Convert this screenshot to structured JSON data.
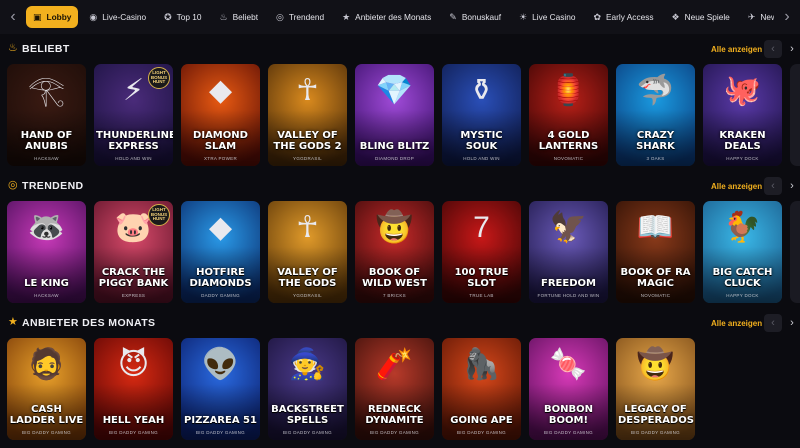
{
  "nav": {
    "items": [
      {
        "label": "Lobby",
        "icon": "lobby-icon",
        "glyph": "▣",
        "active": true
      },
      {
        "label": "Live-Casino",
        "icon": "live-icon",
        "glyph": "◉",
        "active": false
      },
      {
        "label": "Top 10",
        "icon": "medal-icon",
        "glyph": "✪",
        "active": false
      },
      {
        "label": "Beliebt",
        "icon": "flame-icon",
        "glyph": "♨",
        "active": false
      },
      {
        "label": "Trendend",
        "icon": "trend-icon",
        "glyph": "◎",
        "active": false
      },
      {
        "label": "Anbieter des Monats",
        "icon": "star-icon",
        "glyph": "★",
        "active": false
      },
      {
        "label": "Bonuskauf",
        "icon": "bonus-icon",
        "glyph": "✎",
        "active": false
      },
      {
        "label": "Live Casino",
        "icon": "live-casino-icon",
        "glyph": "☀",
        "active": false
      },
      {
        "label": "Early Access",
        "icon": "early-access-icon",
        "glyph": "✿",
        "active": false
      },
      {
        "label": "Neue Spiele",
        "icon": "new-games-icon",
        "glyph": "❖",
        "active": false
      },
      {
        "label": "New Providers",
        "icon": "new-providers-icon",
        "glyph": "✈",
        "active": false
      }
    ]
  },
  "colors": {
    "accent": "#f2b01e",
    "background": "#0b0b10"
  },
  "sections": [
    {
      "title": "BELIEBT",
      "icon": "flame-icon",
      "glyph": "♨",
      "show_all": "Alle anzeigen",
      "games": [
        {
          "name": "Hand of Anubis",
          "provider": "Hacksaw",
          "glyph": "𓂀",
          "bg": [
            "#3a1a12",
            "#1b0c08"
          ]
        },
        {
          "name": "Thunderline Express",
          "provider": "Hold and Win",
          "glyph": "⚡",
          "bg": [
            "#4a2b7a",
            "#1b1240"
          ],
          "badge": "LIGHT BONUS HUNT"
        },
        {
          "name": "Diamond Slam",
          "provider": "Xtra Power",
          "glyph": "◆",
          "bg": [
            "#e85a12",
            "#5a0d05"
          ]
        },
        {
          "name": "Valley of the Gods 2",
          "provider": "Yggdrasil",
          "glyph": "☥",
          "bg": [
            "#d98a1e",
            "#4a2a08"
          ]
        },
        {
          "name": "Bling Blitz",
          "provider": "Diamond Drop",
          "glyph": "💎",
          "bg": [
            "#a04bd8",
            "#3a0f6a"
          ]
        },
        {
          "name": "Mystic Souk",
          "provider": "Hold and Win",
          "glyph": "⚱",
          "bg": [
            "#2a4fb8",
            "#0e1a4a"
          ]
        },
        {
          "name": "4 Gold Lanterns",
          "provider": "Novomatic",
          "glyph": "🏮",
          "bg": [
            "#b82018",
            "#3a0505"
          ]
        },
        {
          "name": "Crazy Shark",
          "provider": "3 Oaks",
          "glyph": "🦈",
          "bg": [
            "#1a9ae0",
            "#0a3a7a"
          ]
        },
        {
          "name": "Kraken Deals",
          "provider": "Happy Dock",
          "glyph": "🐙",
          "bg": [
            "#5a3aa8",
            "#1e1248"
          ]
        }
      ]
    },
    {
      "title": "TRENDEND",
      "icon": "trend-icon",
      "glyph": "◎",
      "show_all": "Alle anzeigen",
      "games": [
        {
          "name": "Le King",
          "provider": "Hacksaw",
          "glyph": "🦝",
          "bg": [
            "#c83ab8",
            "#4a0f5a"
          ]
        },
        {
          "name": "Crack the Piggy Bank",
          "provider": "Express",
          "glyph": "🐷",
          "bg": [
            "#d84a6a",
            "#5a1228"
          ],
          "badge": "LIGHT BONUS HUNT"
        },
        {
          "name": "Hotfire Diamonds",
          "provider": "Daddy Gaming",
          "glyph": "◆",
          "bg": [
            "#2a9ae8",
            "#0a2a6a"
          ]
        },
        {
          "name": "Valley of the Gods",
          "provider": "Yggdrasil",
          "glyph": "☥",
          "bg": [
            "#e09a2a",
            "#5a3508"
          ]
        },
        {
          "name": "Book of Wild West",
          "provider": "7 Bricks",
          "glyph": "🤠",
          "bg": [
            "#c82a2a",
            "#3a0a0a"
          ]
        },
        {
          "name": "100 True Slot",
          "provider": "True Lab",
          "glyph": "7",
          "bg": [
            "#c81818",
            "#3a0505"
          ]
        },
        {
          "name": "Freedom",
          "provider": "Fortune Hold and Win",
          "glyph": "🦅",
          "bg": [
            "#6a5ab8",
            "#1e1848"
          ]
        },
        {
          "name": "Book of Ra Magic",
          "provider": "Novomatic",
          "glyph": "📖",
          "bg": [
            "#8a3a1a",
            "#2a0f05"
          ]
        },
        {
          "name": "Big Catch Cluck",
          "provider": "Happy Dock",
          "glyph": "🐓",
          "bg": [
            "#3ab8e8",
            "#1a5a8a"
          ]
        }
      ]
    },
    {
      "title": "ANBIETER DES MONATS",
      "icon": "star-icon",
      "glyph": "★",
      "show_all": "Alle anzeigen",
      "games": [
        {
          "name": "Cash Ladder Live",
          "provider": "Big Daddy Gaming",
          "glyph": "🧔",
          "bg": [
            "#e8a02a",
            "#7a3a08"
          ]
        },
        {
          "name": "Hell Yeah",
          "provider": "Big Daddy Gaming",
          "glyph": "😈",
          "bg": [
            "#d82a12",
            "#5a0505"
          ]
        },
        {
          "name": "Pizzarea 51",
          "provider": "Big Daddy Gaming",
          "glyph": "👽",
          "bg": [
            "#2a6ae0",
            "#0a1e6a"
          ]
        },
        {
          "name": "Backstreet Spells",
          "provider": "Big Daddy Gaming",
          "glyph": "🧙",
          "bg": [
            "#4a3a8a",
            "#1a1238"
          ]
        },
        {
          "name": "Redneck Dynamite",
          "provider": "Big Daddy Gaming",
          "glyph": "🧨",
          "bg": [
            "#b83a2a",
            "#3a0f0a"
          ]
        },
        {
          "name": "Going Ape",
          "provider": "Big Daddy Gaming",
          "glyph": "🦍",
          "bg": [
            "#d8481a",
            "#5a1505"
          ]
        },
        {
          "name": "Bonbon Boom!",
          "provider": "Big Daddy Gaming",
          "glyph": "🍬",
          "bg": [
            "#d83ab8",
            "#5a0f5a"
          ]
        },
        {
          "name": "Legacy of Desperados",
          "provider": "Big Daddy Gaming",
          "glyph": "🤠",
          "bg": [
            "#e8a84a",
            "#7a4a18"
          ]
        }
      ]
    }
  ]
}
